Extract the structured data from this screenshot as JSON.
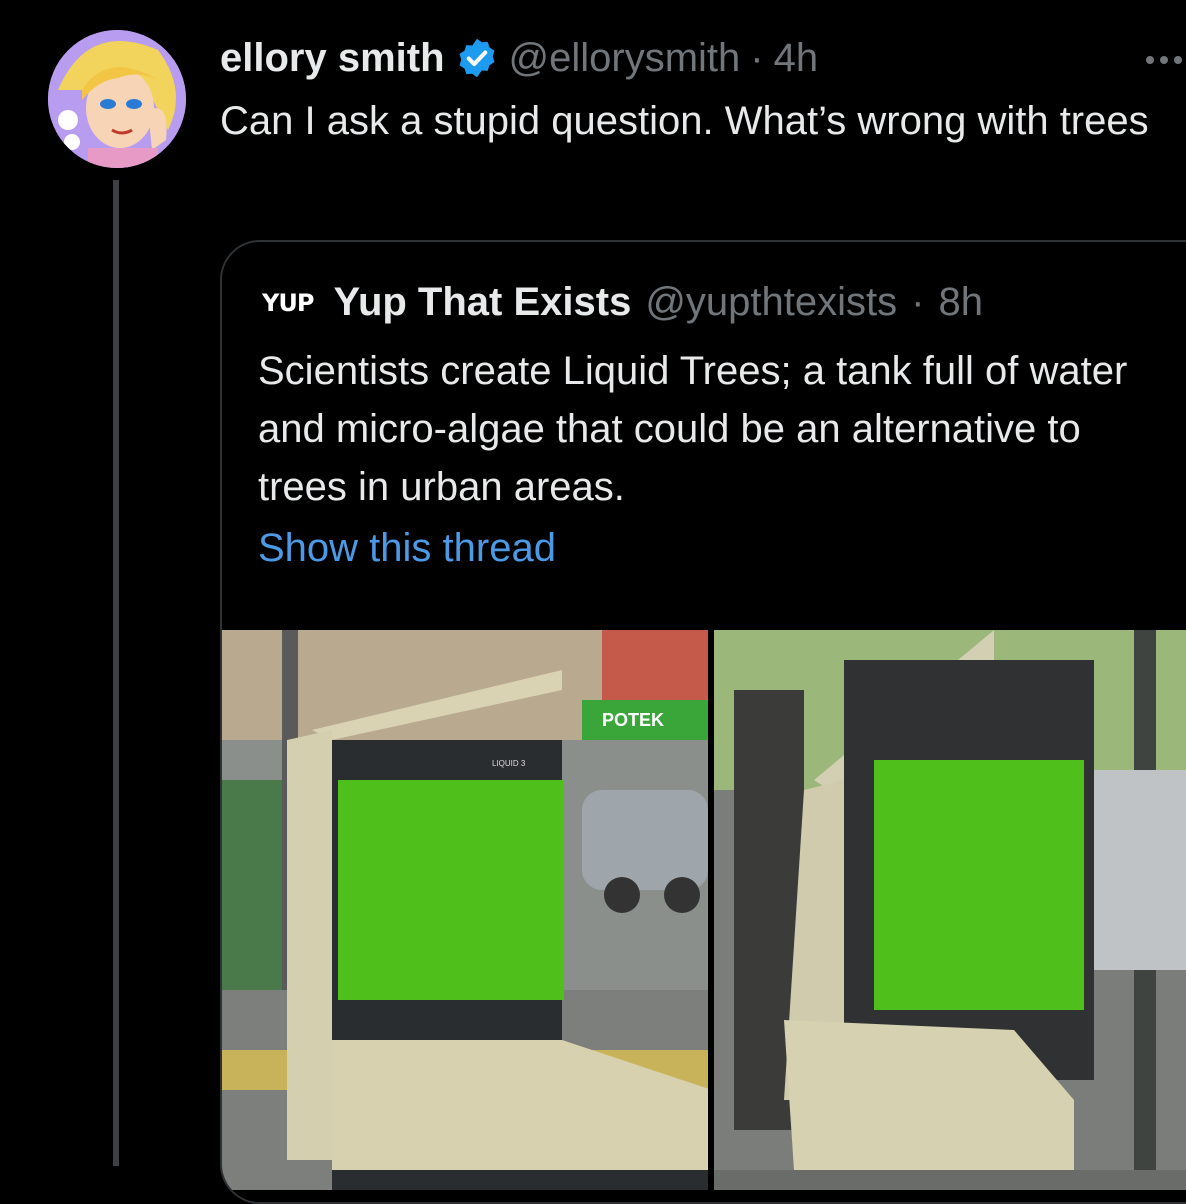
{
  "tweet": {
    "display_name": "ellory smith",
    "handle": "@ellorysmith",
    "separator": "·",
    "time": "4h",
    "text": "Can I ask a stupid question. What’s wrong with trees"
  },
  "quoted_tweet": {
    "logo_text": "YUP",
    "display_name": "Yup That Exists",
    "handle": "@yupthtexists",
    "separator": "·",
    "time": "8h",
    "text": "Scientists create Liquid Trees; a tank full of water and micro-algae that could be an alternative to trees in urban areas.",
    "show_thread": "Show this thread"
  },
  "media": {
    "image1_signs": [
      "POTEK"
    ],
    "image1_panel_label": "LIQUID 3"
  },
  "colors": {
    "background": "#000000",
    "text": "#e7e9ea",
    "secondary": "#71767b",
    "link": "#4c9ae6",
    "verified": "#1d9bf0",
    "algae_green": "#4fbf1c"
  }
}
